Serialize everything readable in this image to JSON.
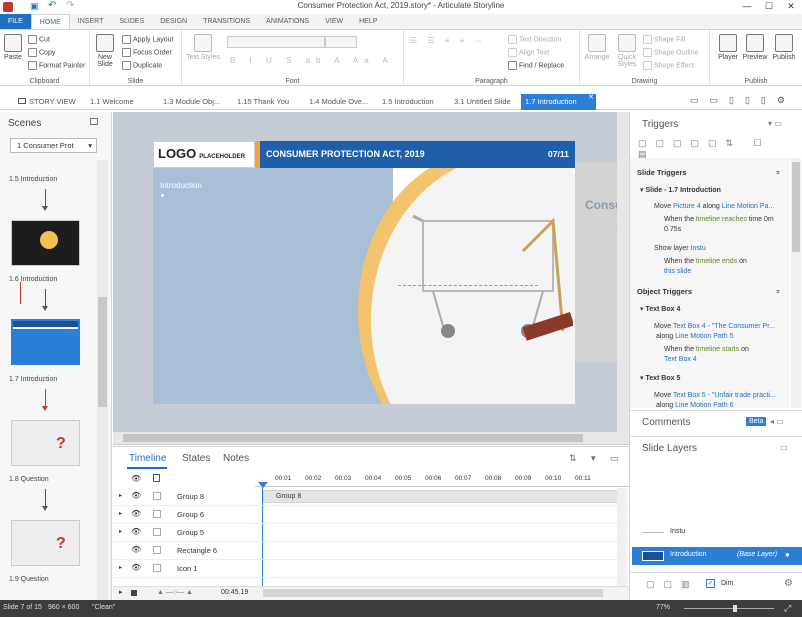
{
  "window": {
    "title": "Consumer Protection Act, 2019.story* - Articulate Storyline",
    "min": "—",
    "max": "☐",
    "close": "✕"
  },
  "ribbon_tabs": [
    "FILE",
    "HOME",
    "INSERT",
    "SLIDES",
    "DESIGN",
    "TRANSITIONS",
    "ANIMATIONS",
    "VIEW",
    "HELP"
  ],
  "clipboard": {
    "paste": "Paste",
    "cut": "Cut",
    "copy": "Copy",
    "format_painter": "Format Painter",
    "label": "Clipboard"
  },
  "slide_grp": {
    "new_slide": "New Slide",
    "apply_layout": "Apply Layout",
    "focus_order": "Focus Order",
    "duplicate": "Duplicate",
    "label": "Slide"
  },
  "font_grp": {
    "text_styles": "Text Styles",
    "label": "Font"
  },
  "para_grp": {
    "text_direction": "Text Direction",
    "align_text": "Align Text",
    "find_replace": "Find / Replace",
    "label": "Paragraph"
  },
  "drawing_grp": {
    "arrange": "Arrange",
    "quick_styles": "Quick Styles",
    "shape_fill": "Shape Fill",
    "shape_outline": "Shape Outline",
    "shape_effect": "Shape Effect",
    "label": "Drawing"
  },
  "publish_grp": {
    "player": "Player",
    "preview": "Preview",
    "publish": "Publish",
    "label": "Publish"
  },
  "slide_tabs": [
    "STORY VIEW",
    "1.1 Welcome",
    "1.3 Module Obj...",
    "1.15 Thank You",
    "1.4 Module Ove...",
    "1.5 Introduction",
    "3.1 Untitled Slide",
    "1.7 Introduction"
  ],
  "scenes": {
    "title": "Scenes",
    "dropdown": "1 Consumer Prot",
    "items": [
      "1.5 Introduction",
      "1.6 Introduction",
      "1.7 Introduction",
      "1.8 Question",
      "1.9 Question"
    ]
  },
  "slide": {
    "logo": "LOGO",
    "logo_sub": "PLACEHOLDER",
    "header": "CONSUMER PROTECTION ACT, 2019",
    "page": "07/11",
    "intro": "Introduction",
    "bg_text1": "Consum",
    "bg_text2": "A"
  },
  "timeline": {
    "tabs": [
      "Timeline",
      "States",
      "Notes"
    ],
    "ticks": [
      "00:01",
      "00:02",
      "00:03",
      "00:04",
      "00:05",
      "00:06",
      "00:07",
      "00:08",
      "00:09",
      "00:10",
      "00:11"
    ],
    "rows": [
      "Group 8",
      "Group 6",
      "Group 5",
      "Rectangle 6",
      "Icon 1"
    ],
    "bar_label": "Group 8",
    "end_time": "00:45.19"
  },
  "triggers": {
    "title": "Triggers",
    "slide_triggers": "Slide Triggers",
    "slide_name": "Slide - 1.7 Introduction",
    "t1a": "Move",
    "t1b": "Picture 4",
    "t1c": "along",
    "t1d": "Line Motion Pa...",
    "t1e": "When the",
    "t1f": "timeline reaches",
    "t1g": "time 0m",
    "t1h": "0.75s",
    "t2a": "Show layer",
    "t2b": "Instu",
    "t2c": "When the",
    "t2d": "timeline ends",
    "t2e": "on",
    "t2f": "this slide",
    "object_triggers": "Object Triggers",
    "tb4": "Text Box 4",
    "t3a": "Move",
    "t3b": "Text Box 4 - \"The Consumer Pr...",
    "t3c": "along",
    "t3d": "Line Motion Path 5",
    "t3e": "When the",
    "t3f": "timeline starts",
    "t3g": "on",
    "t3h": "Text Box 4",
    "tb5": "Text Box 5",
    "t4a": "Move",
    "t4b": "Text Box 5 - \"Unfair trade practi...",
    "t4c": "along",
    "t4d": "Line Motion Path 6"
  },
  "comments": {
    "title": "Comments",
    "badge": "Beta"
  },
  "layers": {
    "title": "Slide Layers",
    "layer1": "Instu",
    "base": "Introduction",
    "base_tag": "(Base Layer)",
    "dim": "Dim"
  },
  "status": {
    "slide": "Slide 7 of 15",
    "size": "960 × 600",
    "theme": "\"Clean\"",
    "zoom": "77%"
  }
}
